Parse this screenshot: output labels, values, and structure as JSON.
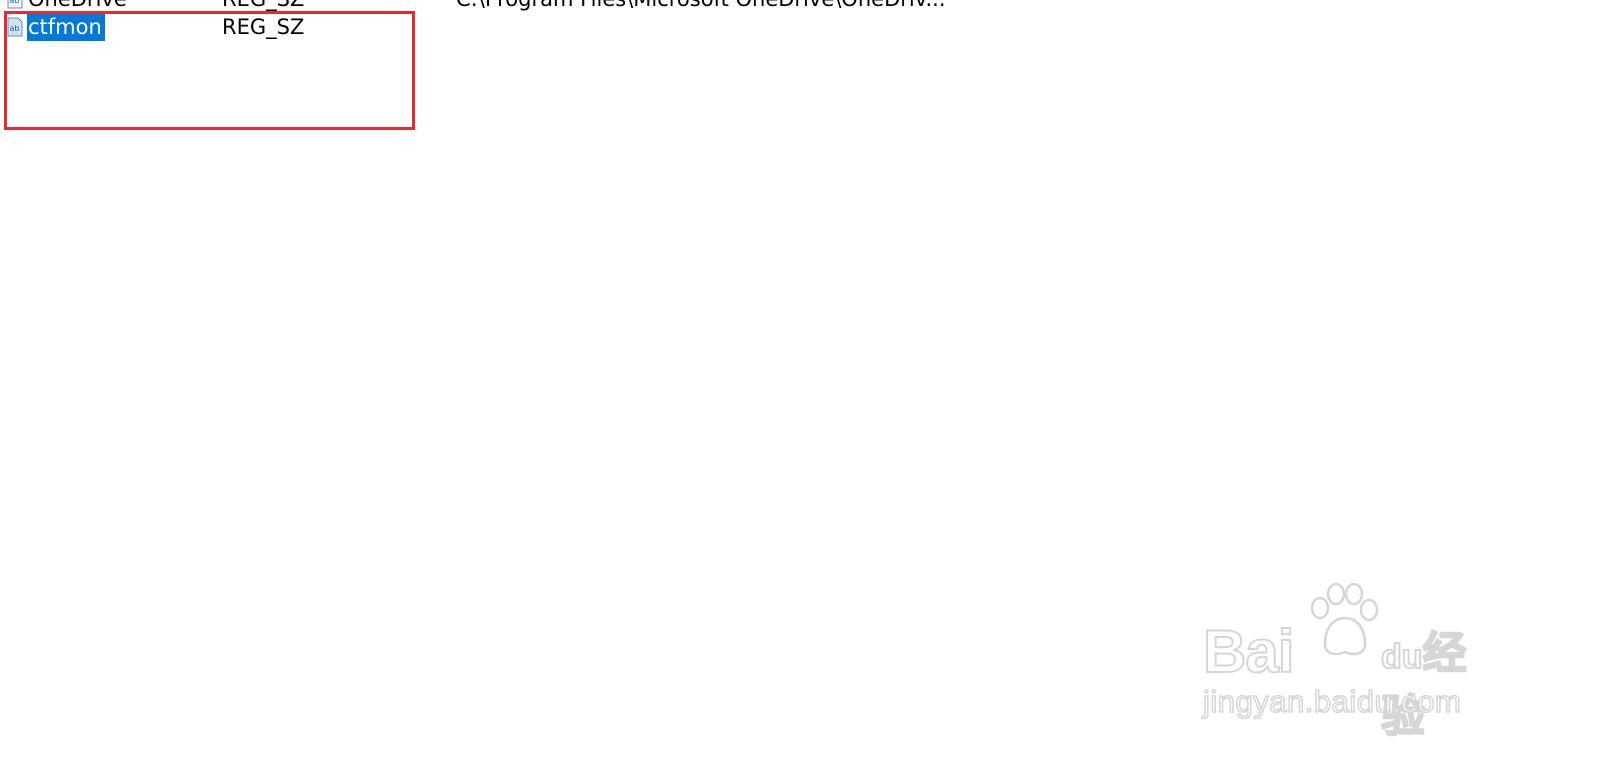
{
  "registry": {
    "rows": [
      {
        "name": "OneDrive",
        "type": "REG_SZ",
        "data": "C:\\Program Files\\Microsoft OneDrive\\OneDriv...",
        "icon": "string-value-icon",
        "selected": false
      },
      {
        "name": "ctfmon",
        "type": "REG_SZ",
        "data": "",
        "icon": "string-value-icon",
        "selected": true
      }
    ]
  },
  "annotation": {
    "color": "#e32b33"
  },
  "watermark": {
    "brand": "Bai",
    "brand_suffix": "du",
    "product": "经验",
    "url": "jingyan.baidu.com"
  },
  "colors": {
    "selection": "#0078d7",
    "highlight_box": "#e32b33"
  }
}
